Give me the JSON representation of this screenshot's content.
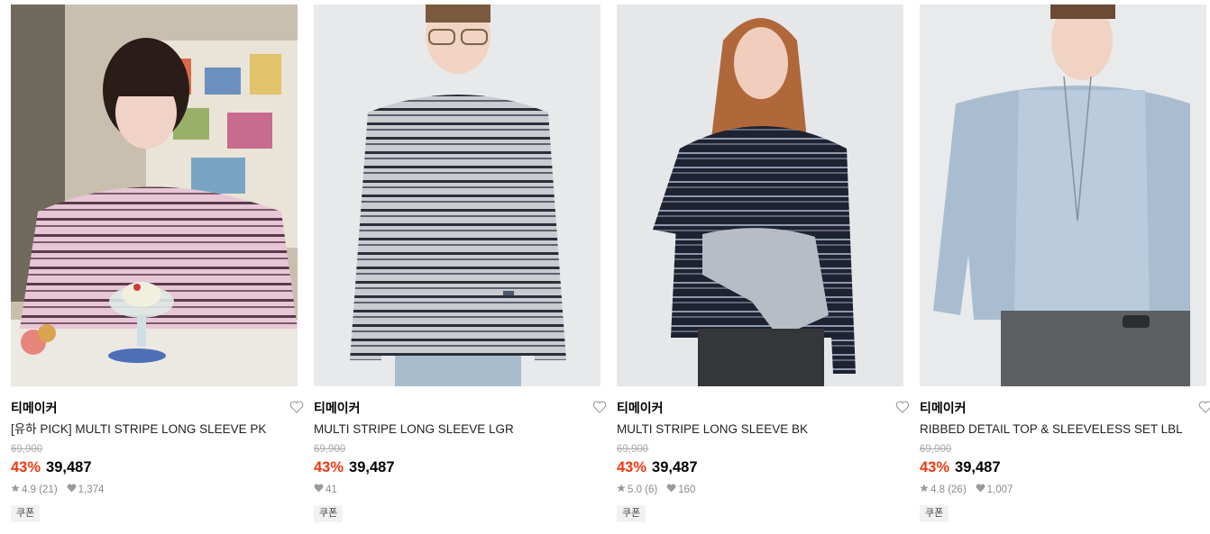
{
  "products": [
    {
      "brand": "티메이커",
      "name": "[유하 PICK] MULTI STRIPE LONG SLEEVE PK",
      "original_price": "69,900",
      "discount": "43%",
      "price": "39,487",
      "rating": "4.9",
      "reviews": "(21)",
      "likes": "1,374",
      "coupon": "쿠폰"
    },
    {
      "brand": "티메이커",
      "name": "MULTI STRIPE LONG SLEEVE LGR",
      "original_price": "69,900",
      "discount": "43%",
      "price": "39,487",
      "likes": "41",
      "coupon": "쿠폰"
    },
    {
      "brand": "티메이커",
      "name": "MULTI STRIPE LONG SLEEVE BK",
      "original_price": "69,900",
      "discount": "43%",
      "price": "39,487",
      "rating": "5.0",
      "reviews": "(6)",
      "likes": "160",
      "coupon": "쿠폰"
    },
    {
      "brand": "티메이커",
      "name": "RIBBED DETAIL TOP & SLEEVELESS SET LBL",
      "original_price": "69,900",
      "discount": "43%",
      "price": "39,487",
      "rating": "4.8",
      "reviews": "(26)",
      "likes": "1,007",
      "coupon": "쿠폰"
    }
  ],
  "colors": {
    "discount": "#f1380f",
    "muted": "#8a8a8a",
    "strike": "#aaaaaa"
  },
  "icons": {
    "wishlist": "heart-outline-icon",
    "rating": "star-icon",
    "likes": "heart-filled-icon"
  }
}
